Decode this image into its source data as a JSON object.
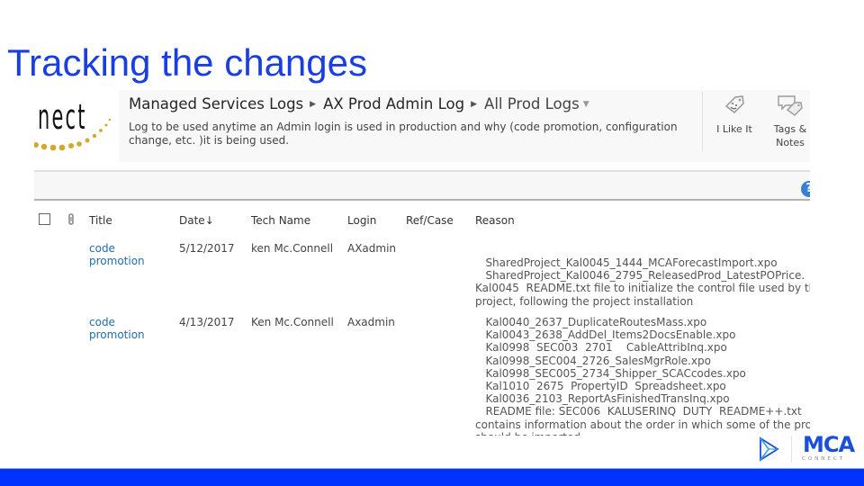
{
  "slide": {
    "title": "Tracking the changes",
    "accent_color": "#1a3fe0",
    "bottom_bar_color": "#0033ff"
  },
  "sharepoint": {
    "logo_text": "nect",
    "breadcrumb": {
      "items": [
        "Managed Services Logs",
        "AX Prod Admin Log",
        "All Prod Logs"
      ]
    },
    "description_line1": "Log to be used anytime an  Admin login is used in production and why (code promotion, configuration",
    "description_line2": "change, etc. )it is being used.",
    "actions": {
      "like_label": "I Like It",
      "tags_label_line1": "Tags &",
      "tags_label_line2": "Notes"
    },
    "help_glyph": "?",
    "columns": {
      "title": "Title",
      "date": "Date",
      "date_sort": "↓",
      "tech_name": "Tech Name",
      "login": "Login",
      "ref_case": "Ref/Case",
      "reason": "Reason"
    },
    "rows": [
      {
        "title_line1": "code",
        "title_line2": "promotion",
        "date": "5/12/2017",
        "tech_name": "ken Mc.Connell",
        "login": "AXadmin",
        "ref_case": "",
        "reason": "   SharedProject_Kal0045_1444_MCAForecastImport.xpo\n   SharedProject_Kal0046_2795_ReleasedProd_LatestPOPrice.\nKal0045  README.txt file to initialize the control file used by th\nproject, following the project installation"
      },
      {
        "title_line1": "code",
        "title_line2": "promotion",
        "date": "4/13/2017",
        "tech_name": "Ken Mc.Connell",
        "login": "Axadmin",
        "ref_case": "",
        "reason": "   Kal0040_2637_DuplicateRoutesMass.xpo\n   Kal0043_2638_AddDel_Items2DocsEnable.xpo\n   Kal0998  SEC003  2701    CableAttribInq.xpo\n   Kal0998_SEC004_2726_SalesMgrRole.xpo\n   Kal0998_SEC005_2734_Shipper_SCACcodes.xpo\n   Kal1010  2675  PropertyID  Spreadsheet.xpo\n   Kal0036_2103_ReportAsFinishedTransInq.xpo\n   README file: SEC006  KALUSERINQ  DUTY  README++.txt\ncontains information about the order in which some of the pro\nshould be imported"
      }
    ]
  },
  "brand": {
    "name": "MCA",
    "subtitle": "CONNECT",
    "color_dark": "#1a4fd8",
    "color_light": "#2aa3e8"
  }
}
